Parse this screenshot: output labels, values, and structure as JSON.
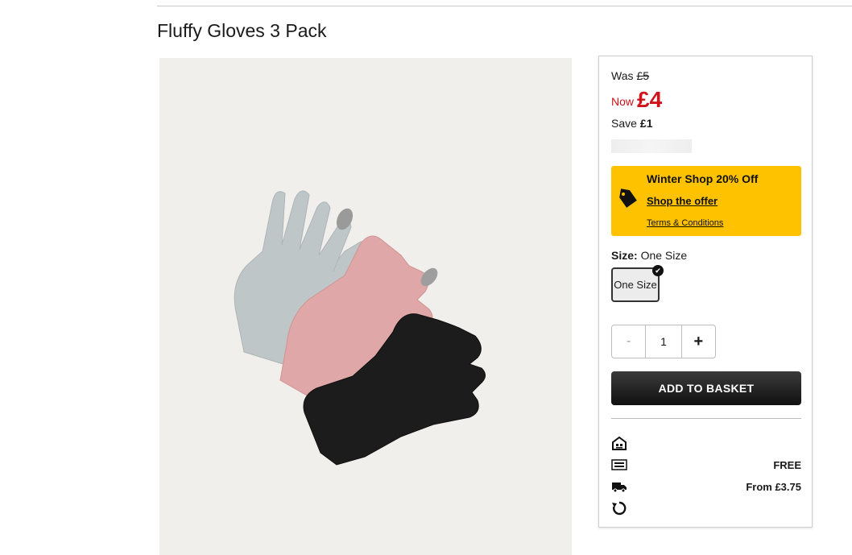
{
  "product": {
    "title": "Fluffy Gloves 3 Pack"
  },
  "pricing": {
    "was_label": "Was",
    "was_price": "£5",
    "now_label": "Now",
    "now_price": "£4",
    "save_label": "Save",
    "save_amount": "£1"
  },
  "promo": {
    "title": "Winter Shop 20% Off",
    "link": "Shop the offer",
    "terms": "Terms & Conditions",
    "color": "#fec200"
  },
  "size": {
    "label": "Size:",
    "selected": "One Size",
    "options": [
      "One Size"
    ]
  },
  "quantity": {
    "minus": "-",
    "value": "1",
    "plus": "+"
  },
  "basket": {
    "add_label": "ADD TO BASKET"
  },
  "delivery": [
    {
      "icon": "store-icon",
      "value": ""
    },
    {
      "icon": "click-and-collect-icon",
      "value": "FREE"
    },
    {
      "icon": "delivery-truck-icon",
      "value": "From £3.75"
    },
    {
      "icon": "returns-icon",
      "value": ""
    }
  ],
  "colors": {
    "sale_red": "#d0121b",
    "button_dark": "#1a1a1a"
  }
}
